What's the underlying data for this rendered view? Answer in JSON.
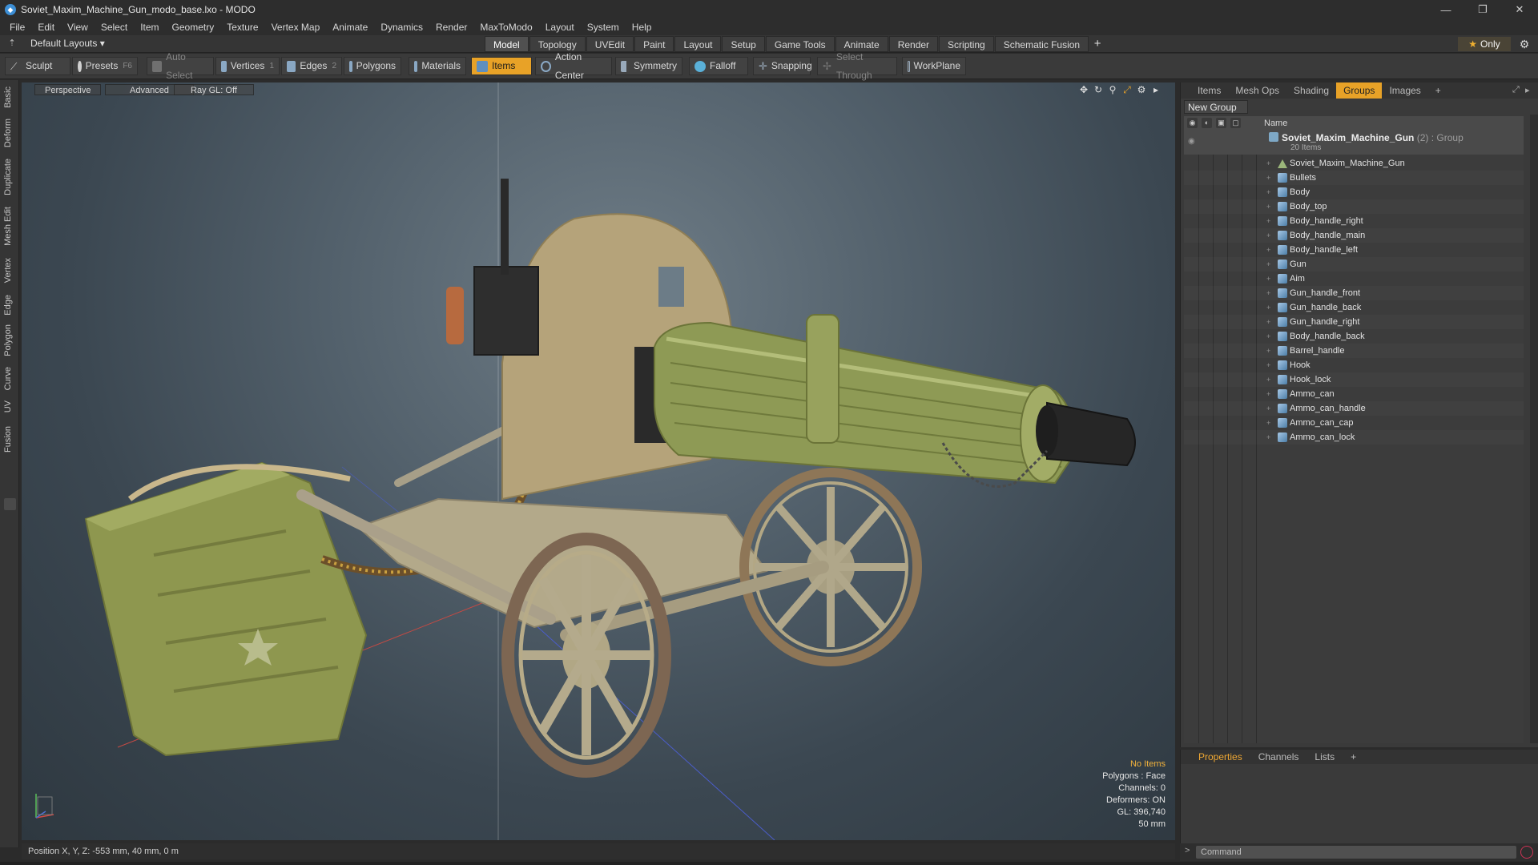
{
  "window": {
    "title": "Soviet_Maxim_Machine_Gun_modo_base.lxo - MODO",
    "controls": [
      "minimize",
      "restore",
      "close"
    ]
  },
  "menu": [
    "File",
    "Edit",
    "View",
    "Select",
    "Item",
    "Geometry",
    "Texture",
    "Vertex Map",
    "Animate",
    "Dynamics",
    "Render",
    "MaxToModo",
    "Layout",
    "System",
    "Help"
  ],
  "layout_bar": {
    "layout_select": "Default Layouts ▾",
    "tabs": [
      "Model",
      "Topology",
      "UVEdit",
      "Paint",
      "Layout",
      "Setup",
      "Game Tools",
      "Animate",
      "Render",
      "Scripting",
      "Schematic Fusion"
    ],
    "active_tab": "Model",
    "only_label": "Only"
  },
  "toolbar": {
    "sculpt": "Sculpt",
    "presets": "Presets",
    "presets_key": "F6",
    "auto_select": "Auto Select",
    "vertices": "Vertices",
    "vertices_count": "1",
    "edges": "Edges",
    "edges_count": "2",
    "polygons": "Polygons",
    "materials": "Materials",
    "items": "Items",
    "action_center": "Action Center",
    "symmetry": "Symmetry",
    "falloff": "Falloff",
    "snapping": "Snapping",
    "select_through": "Select Through",
    "workplane": "WorkPlane"
  },
  "left_tabs": [
    "Basic",
    "Deform",
    "Duplicate",
    "Mesh Edit",
    "Vertex",
    "Edge",
    "Polygon",
    "Curve",
    "UV",
    "Fusion"
  ],
  "viewport": {
    "view_mode": "Perspective",
    "shading": "Advanced",
    "raygl": "Ray GL: Off",
    "info": {
      "selection": "No Items",
      "polygons": "Polygons : Face",
      "channels": "Channels: 0",
      "deformers": "Deformers: ON",
      "gl": "GL: 396,740",
      "scale": "50 mm"
    }
  },
  "status": {
    "position": "Position X, Y, Z:  -553 mm, 40 mm, 0 m"
  },
  "right_panel": {
    "tabs": [
      "Items",
      "Mesh Ops",
      "Shading",
      "Groups",
      "Images"
    ],
    "active_tab": "Groups",
    "new_group": "New Group",
    "name_col": "Name",
    "group": {
      "name": "Soviet_Maxim_Machine_Gun",
      "count": "(2)",
      "type": ": Group",
      "items_label": "20 Items"
    },
    "items": [
      "Soviet_Maxim_Machine_Gun",
      "Bullets",
      "Body",
      "Body_top",
      "Body_handle_right",
      "Body_handle_main",
      "Body_handle_left",
      "Gun",
      "Aim",
      "Gun_handle_front",
      "Gun_handle_back",
      "Gun_handle_right",
      "Body_handle_back",
      "Barrel_handle",
      "Hook",
      "Hook_lock",
      "Ammo_can",
      "Ammo_can_handle",
      "Ammo_can_cap",
      "Ammo_can_lock"
    ]
  },
  "props_panel": {
    "tabs": [
      "Properties",
      "Channels",
      "Lists"
    ],
    "active_tab": "Properties"
  },
  "command": {
    "placeholder": "Command"
  },
  "colors": {
    "accent": "#e8a227",
    "info_highlight": "#f1b23c",
    "model_olive": "#8f9a5a",
    "shield_tan": "#b9a57a"
  }
}
